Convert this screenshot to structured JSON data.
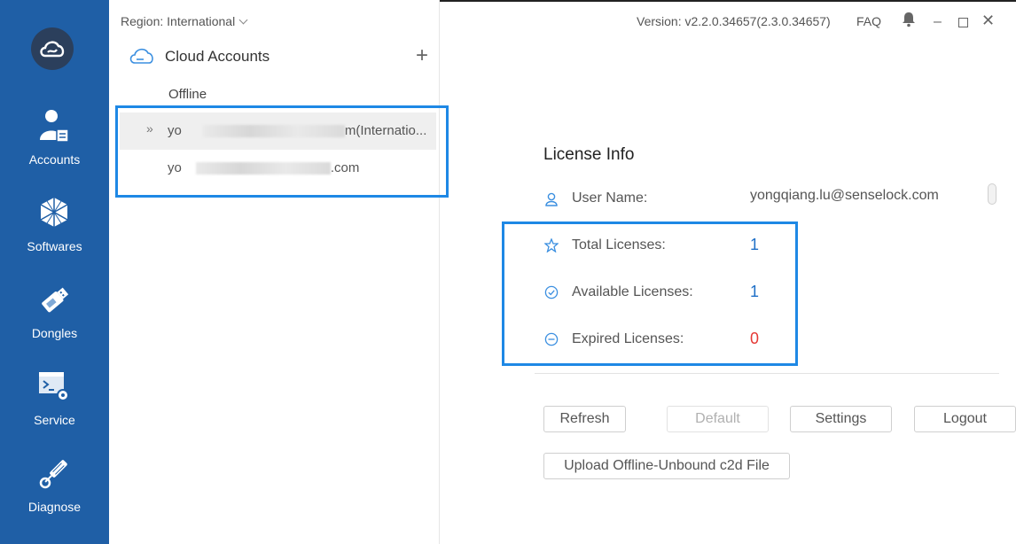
{
  "sidebar": {
    "items": [
      {
        "label": "Accounts",
        "icon": "accounts-icon"
      },
      {
        "label": "Softwares",
        "icon": "softwares-icon"
      },
      {
        "label": "Dongles",
        "icon": "dongle-icon"
      },
      {
        "label": "Service",
        "icon": "service-icon"
      },
      {
        "label": "Diagnose",
        "icon": "diagnose-icon"
      }
    ],
    "logo_icon": "cloud-logo-icon"
  },
  "region": {
    "label": "Region: International"
  },
  "cloud_accounts": {
    "title": "Cloud Accounts",
    "add_label": "+",
    "offline_label": "Offline",
    "accounts": [
      {
        "prefix": "yo",
        "suffix": "m(Internatio...",
        "selected": true
      },
      {
        "prefix": "yo",
        "suffix": ".com",
        "selected": false
      }
    ]
  },
  "topbar": {
    "version": "Version: v2.2.0.34657(2.3.0.34657)",
    "faq": "FAQ",
    "minimize": "–",
    "close": "✕"
  },
  "license": {
    "title": "License Info",
    "user_label": "User Name:",
    "user_value": "yongqiang.lu@senselock.com",
    "total_label": "Total Licenses:",
    "total_value": "1",
    "available_label": "Available Licenses:",
    "available_value": "1",
    "expired_label": "Expired Licenses:",
    "expired_value": "0"
  },
  "buttons": {
    "refresh": "Refresh",
    "default": "Default",
    "settings": "Settings",
    "logout": "Logout",
    "upload": "Upload Offline-Unbound c2d File"
  },
  "colors": {
    "sidebar": "#1f5fa6",
    "accent": "#1e88e5",
    "value_blue": "#1e6fc7",
    "value_red": "#e53935"
  }
}
